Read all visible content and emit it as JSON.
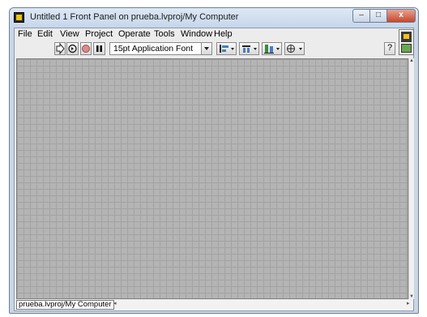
{
  "window": {
    "title": "Untitled 1 Front Panel on prueba.lvproj/My Computer",
    "controls": {
      "minimize": "–",
      "maximize": "□",
      "close": "x"
    }
  },
  "menu": {
    "items": [
      "File",
      "Edit",
      "View",
      "Project",
      "Operate",
      "Tools",
      "Window",
      "Help"
    ]
  },
  "toolbar": {
    "buttons": [
      "run-arrow-icon",
      "run-continuously-icon",
      "abort-icon",
      "pause-icon"
    ],
    "font_select": "15pt Application Font",
    "palettes": [
      "align-objects-icon",
      "distribute-objects-icon",
      "resize-objects-icon",
      "reorder-icon"
    ],
    "help_label": "?"
  },
  "statusbar": {
    "context": "prueba.lvproj/My Computer"
  },
  "colors": {
    "titlebar": "#c6d6ea",
    "canvas": "#b4b4b4",
    "grid": "#a3a3a3",
    "close_button": "#c6462b"
  }
}
